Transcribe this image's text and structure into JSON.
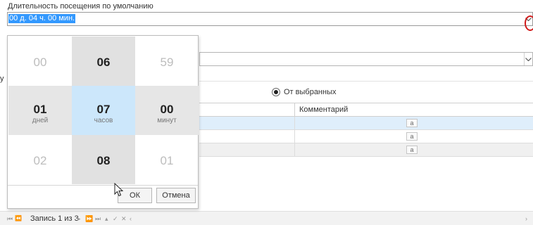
{
  "field": {
    "label": "Длительность посещения по умолчанию",
    "value": "00 д. 04 ч. 00 мин."
  },
  "stray_char": "у",
  "radio": {
    "label": "От выбранных",
    "checked": true
  },
  "grid": {
    "columns": [
      "",
      "Комментарий"
    ],
    "rows": [
      {
        "button": "a",
        "selected": true
      },
      {
        "button": "a",
        "selected": false
      },
      {
        "button": "a",
        "selected": false
      }
    ],
    "colors": {
      "selected_row": "#dfeefb",
      "alt_row": "#f0f0f0"
    }
  },
  "picker": {
    "days": {
      "prev": "00",
      "current": "01",
      "next": "02",
      "unit": "дней"
    },
    "hours": {
      "prev": "06",
      "current": "07",
      "next": "08",
      "unit": "часов"
    },
    "minutes": {
      "prev": "59",
      "current": "00",
      "next": "01",
      "unit": "минут"
    },
    "ok_label": "ОК",
    "cancel_label": "Отмена"
  },
  "pager": {
    "text": "Запись 1 из 3",
    "icons": [
      "first-page-icon",
      "prev-page-group-icon",
      "prev-page-icon",
      "next-page-icon",
      "next-page-group-icon",
      "last-page-icon",
      "add-record-icon",
      "confirm-icon",
      "delete-icon",
      "scroll-left-icon"
    ]
  },
  "colors": {
    "selection": "#3399ff",
    "highlight_cell": "#cce7fb",
    "focus_ring": "#d01818"
  }
}
